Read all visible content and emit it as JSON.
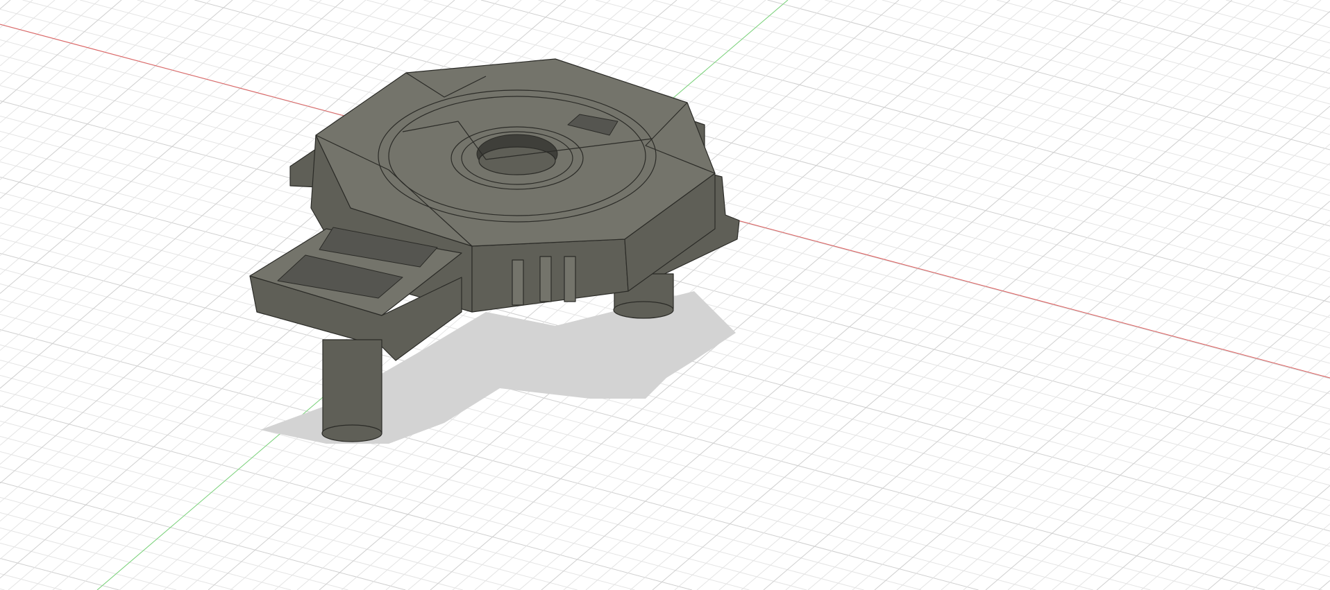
{
  "viewport": {
    "background": "#ffffff",
    "grid_minor_color": "#e4e4e4",
    "grid_major_color": "#cfcfcf",
    "x_axis_color": "#e06060",
    "y_axis_color": "#7ad67a",
    "shadow_color": "#cfcfcf"
  },
  "model": {
    "top_color": "#74746b",
    "side_color": "#5f5f57",
    "dark_color": "#3f3f3a",
    "edge_color": "#2b2b27",
    "mesh_color": "#555550"
  },
  "icons": [
    "origin-x-axis",
    "origin-y-axis",
    "ground-grid"
  ]
}
